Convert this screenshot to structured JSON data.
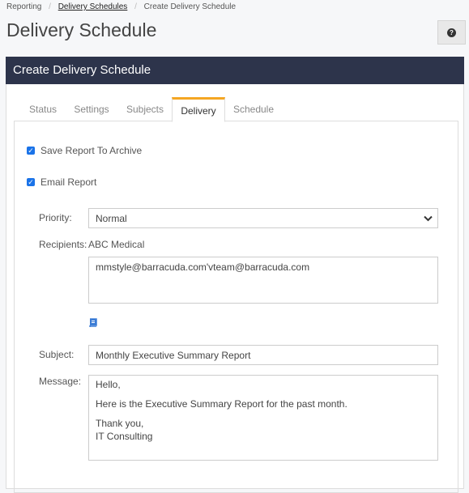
{
  "breadcrumb": {
    "items": [
      "Reporting",
      "Delivery Schedules",
      "Create Delivery Schedule"
    ],
    "separator": "/"
  },
  "page_title": "Delivery Schedule",
  "help_icon": "question-circle-icon",
  "help_glyph": "?",
  "panel_title": "Create Delivery Schedule",
  "tabs": [
    {
      "label": "Status"
    },
    {
      "label": "Settings"
    },
    {
      "label": "Subjects"
    },
    {
      "label": "Delivery",
      "active": true
    },
    {
      "label": "Schedule"
    }
  ],
  "accent_color": "#f5a623",
  "header_color": "#2d344b",
  "form": {
    "save_archive": {
      "label": "Save Report To Archive",
      "checked": true
    },
    "email_report": {
      "label": "Email Report",
      "checked": true
    },
    "priority": {
      "label": "Priority:",
      "value": "Normal"
    },
    "recipients": {
      "label": "Recipients:",
      "company": "ABC Medical",
      "value": "mmstyle@barracuda.com'vteam@barracuda.com",
      "address_book_icon": "address-book-icon"
    },
    "subject": {
      "label": "Subject:",
      "value": "Monthly Executive Summary Report"
    },
    "message": {
      "label": "Message:",
      "lines": [
        "Hello,",
        "",
        "Here is the Executive Summary Report for the past month.",
        "",
        "Thank you,",
        "IT Consulting"
      ]
    }
  }
}
